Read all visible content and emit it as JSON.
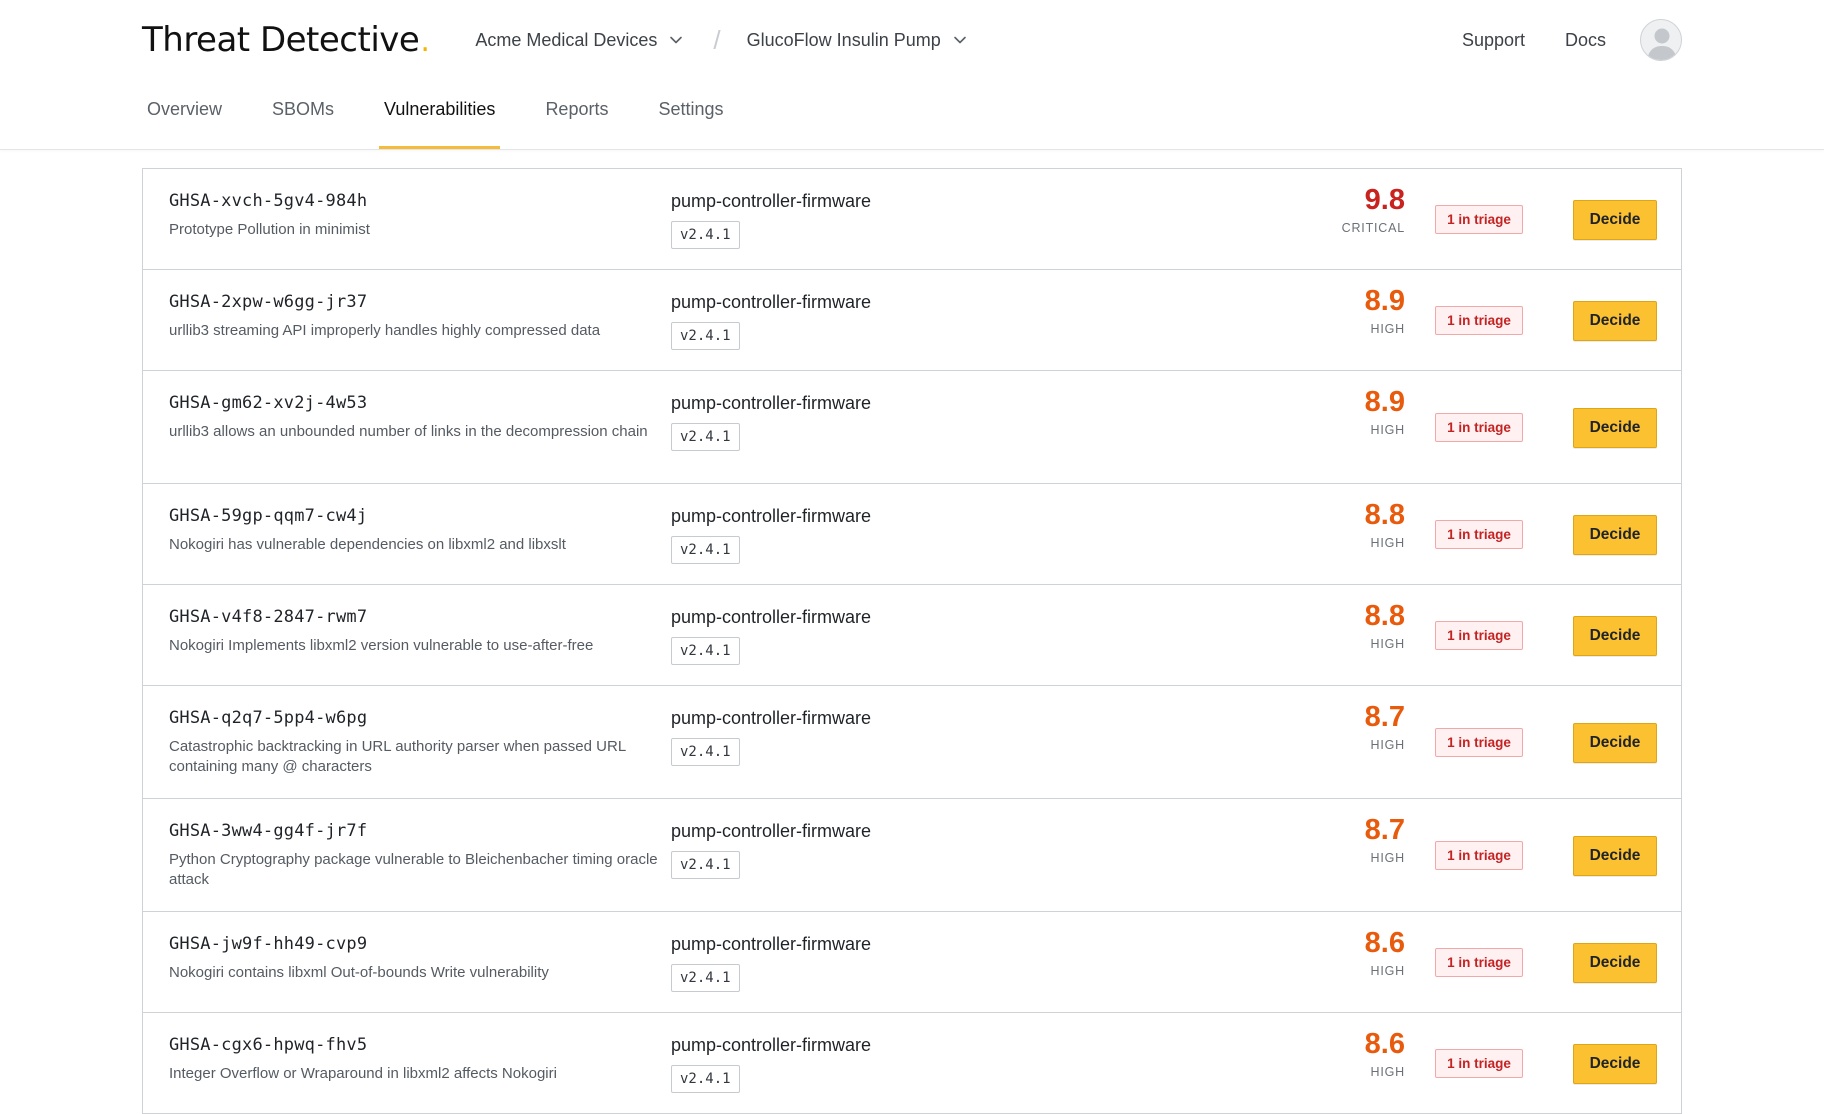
{
  "brand": {
    "name": "Threat Detective",
    "dot": "."
  },
  "breadcrumbs": [
    {
      "label": "Acme Medical Devices"
    },
    {
      "label": "GlucoFlow Insulin Pump"
    }
  ],
  "breadcrumb_separator": "/",
  "top_links": {
    "support": "Support",
    "docs": "Docs"
  },
  "tabs": [
    {
      "label": "Overview",
      "active": false
    },
    {
      "label": "SBOMs",
      "active": false
    },
    {
      "label": "Vulnerabilities",
      "active": true
    },
    {
      "label": "Reports",
      "active": false
    },
    {
      "label": "Settings",
      "active": false
    }
  ],
  "colors": {
    "critical": "#c8231f",
    "high": "#e85a0c",
    "accent": "#fcc131"
  },
  "vulnerabilities": [
    {
      "id": "GHSA-xvch-5gv4-984h",
      "summary": "Prototype Pollution in minimist",
      "package": "pump-controller-firmware",
      "version": "v2.4.1",
      "score": "9.8",
      "severity": "CRITICAL",
      "triage": "1 in triage",
      "action": "Decide"
    },
    {
      "id": "GHSA-2xpw-w6gg-jr37",
      "summary": "urllib3 streaming API improperly handles highly compressed data",
      "package": "pump-controller-firmware",
      "version": "v2.4.1",
      "score": "8.9",
      "severity": "HIGH",
      "triage": "1 in triage",
      "action": "Decide"
    },
    {
      "id": "GHSA-gm62-xv2j-4w53",
      "summary": "urllib3 allows an unbounded number of links in the decompression chain",
      "package": "pump-controller-firmware",
      "version": "v2.4.1",
      "score": "8.9",
      "severity": "HIGH",
      "triage": "1 in triage",
      "action": "Decide"
    },
    {
      "id": "GHSA-59gp-qqm7-cw4j",
      "summary": "Nokogiri has vulnerable dependencies on libxml2 and libxslt",
      "package": "pump-controller-firmware",
      "version": "v2.4.1",
      "score": "8.8",
      "severity": "HIGH",
      "triage": "1 in triage",
      "action": "Decide"
    },
    {
      "id": "GHSA-v4f8-2847-rwm7",
      "summary": "Nokogiri Implements libxml2 version vulnerable to use-after-free",
      "package": "pump-controller-firmware",
      "version": "v2.4.1",
      "score": "8.8",
      "severity": "HIGH",
      "triage": "1 in triage",
      "action": "Decide"
    },
    {
      "id": "GHSA-q2q7-5pp4-w6pg",
      "summary": "Catastrophic backtracking in URL authority parser when passed URL containing many @ characters",
      "package": "pump-controller-firmware",
      "version": "v2.4.1",
      "score": "8.7",
      "severity": "HIGH",
      "triage": "1 in triage",
      "action": "Decide"
    },
    {
      "id": "GHSA-3ww4-gg4f-jr7f",
      "summary": "Python Cryptography package vulnerable to Bleichenbacher timing oracle attack",
      "package": "pump-controller-firmware",
      "version": "v2.4.1",
      "score": "8.7",
      "severity": "HIGH",
      "triage": "1 in triage",
      "action": "Decide"
    },
    {
      "id": "GHSA-jw9f-hh49-cvp9",
      "summary": "Nokogiri contains libxml Out-of-bounds Write vulnerability",
      "package": "pump-controller-firmware",
      "version": "v2.4.1",
      "score": "8.6",
      "severity": "HIGH",
      "triage": "1 in triage",
      "action": "Decide"
    },
    {
      "id": "GHSA-cgx6-hpwq-fhv5",
      "summary": "Integer Overflow or Wraparound in libxml2 affects Nokogiri",
      "package": "pump-controller-firmware",
      "version": "v2.4.1",
      "score": "8.6",
      "severity": "HIGH",
      "triage": "1 in triage",
      "action": "Decide"
    }
  ]
}
